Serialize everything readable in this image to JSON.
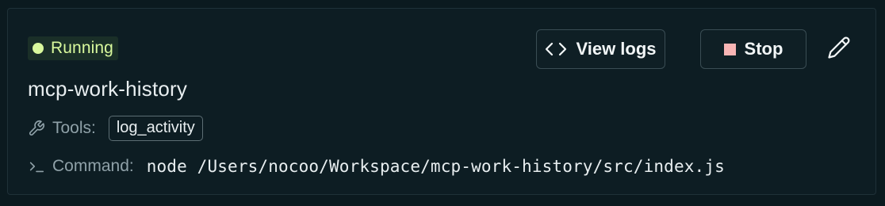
{
  "status": {
    "label": "Running",
    "color": "#d9f99d"
  },
  "server": {
    "name": "mcp-work-history"
  },
  "tools": {
    "label": "Tools:",
    "icon": "wrench-icon",
    "items": [
      "log_activity"
    ]
  },
  "command": {
    "label": "Command:",
    "icon": "terminal-prompt-icon",
    "value": "node /Users/nocoo/Workspace/mcp-work-history/src/index.js"
  },
  "actions": {
    "view_logs_label": "View logs",
    "view_logs_icon": "code-brackets-icon",
    "stop_label": "Stop",
    "stop_icon": "stop-square-icon",
    "stop_color": "#f8b4b4",
    "edit_icon": "pencil-icon"
  }
}
